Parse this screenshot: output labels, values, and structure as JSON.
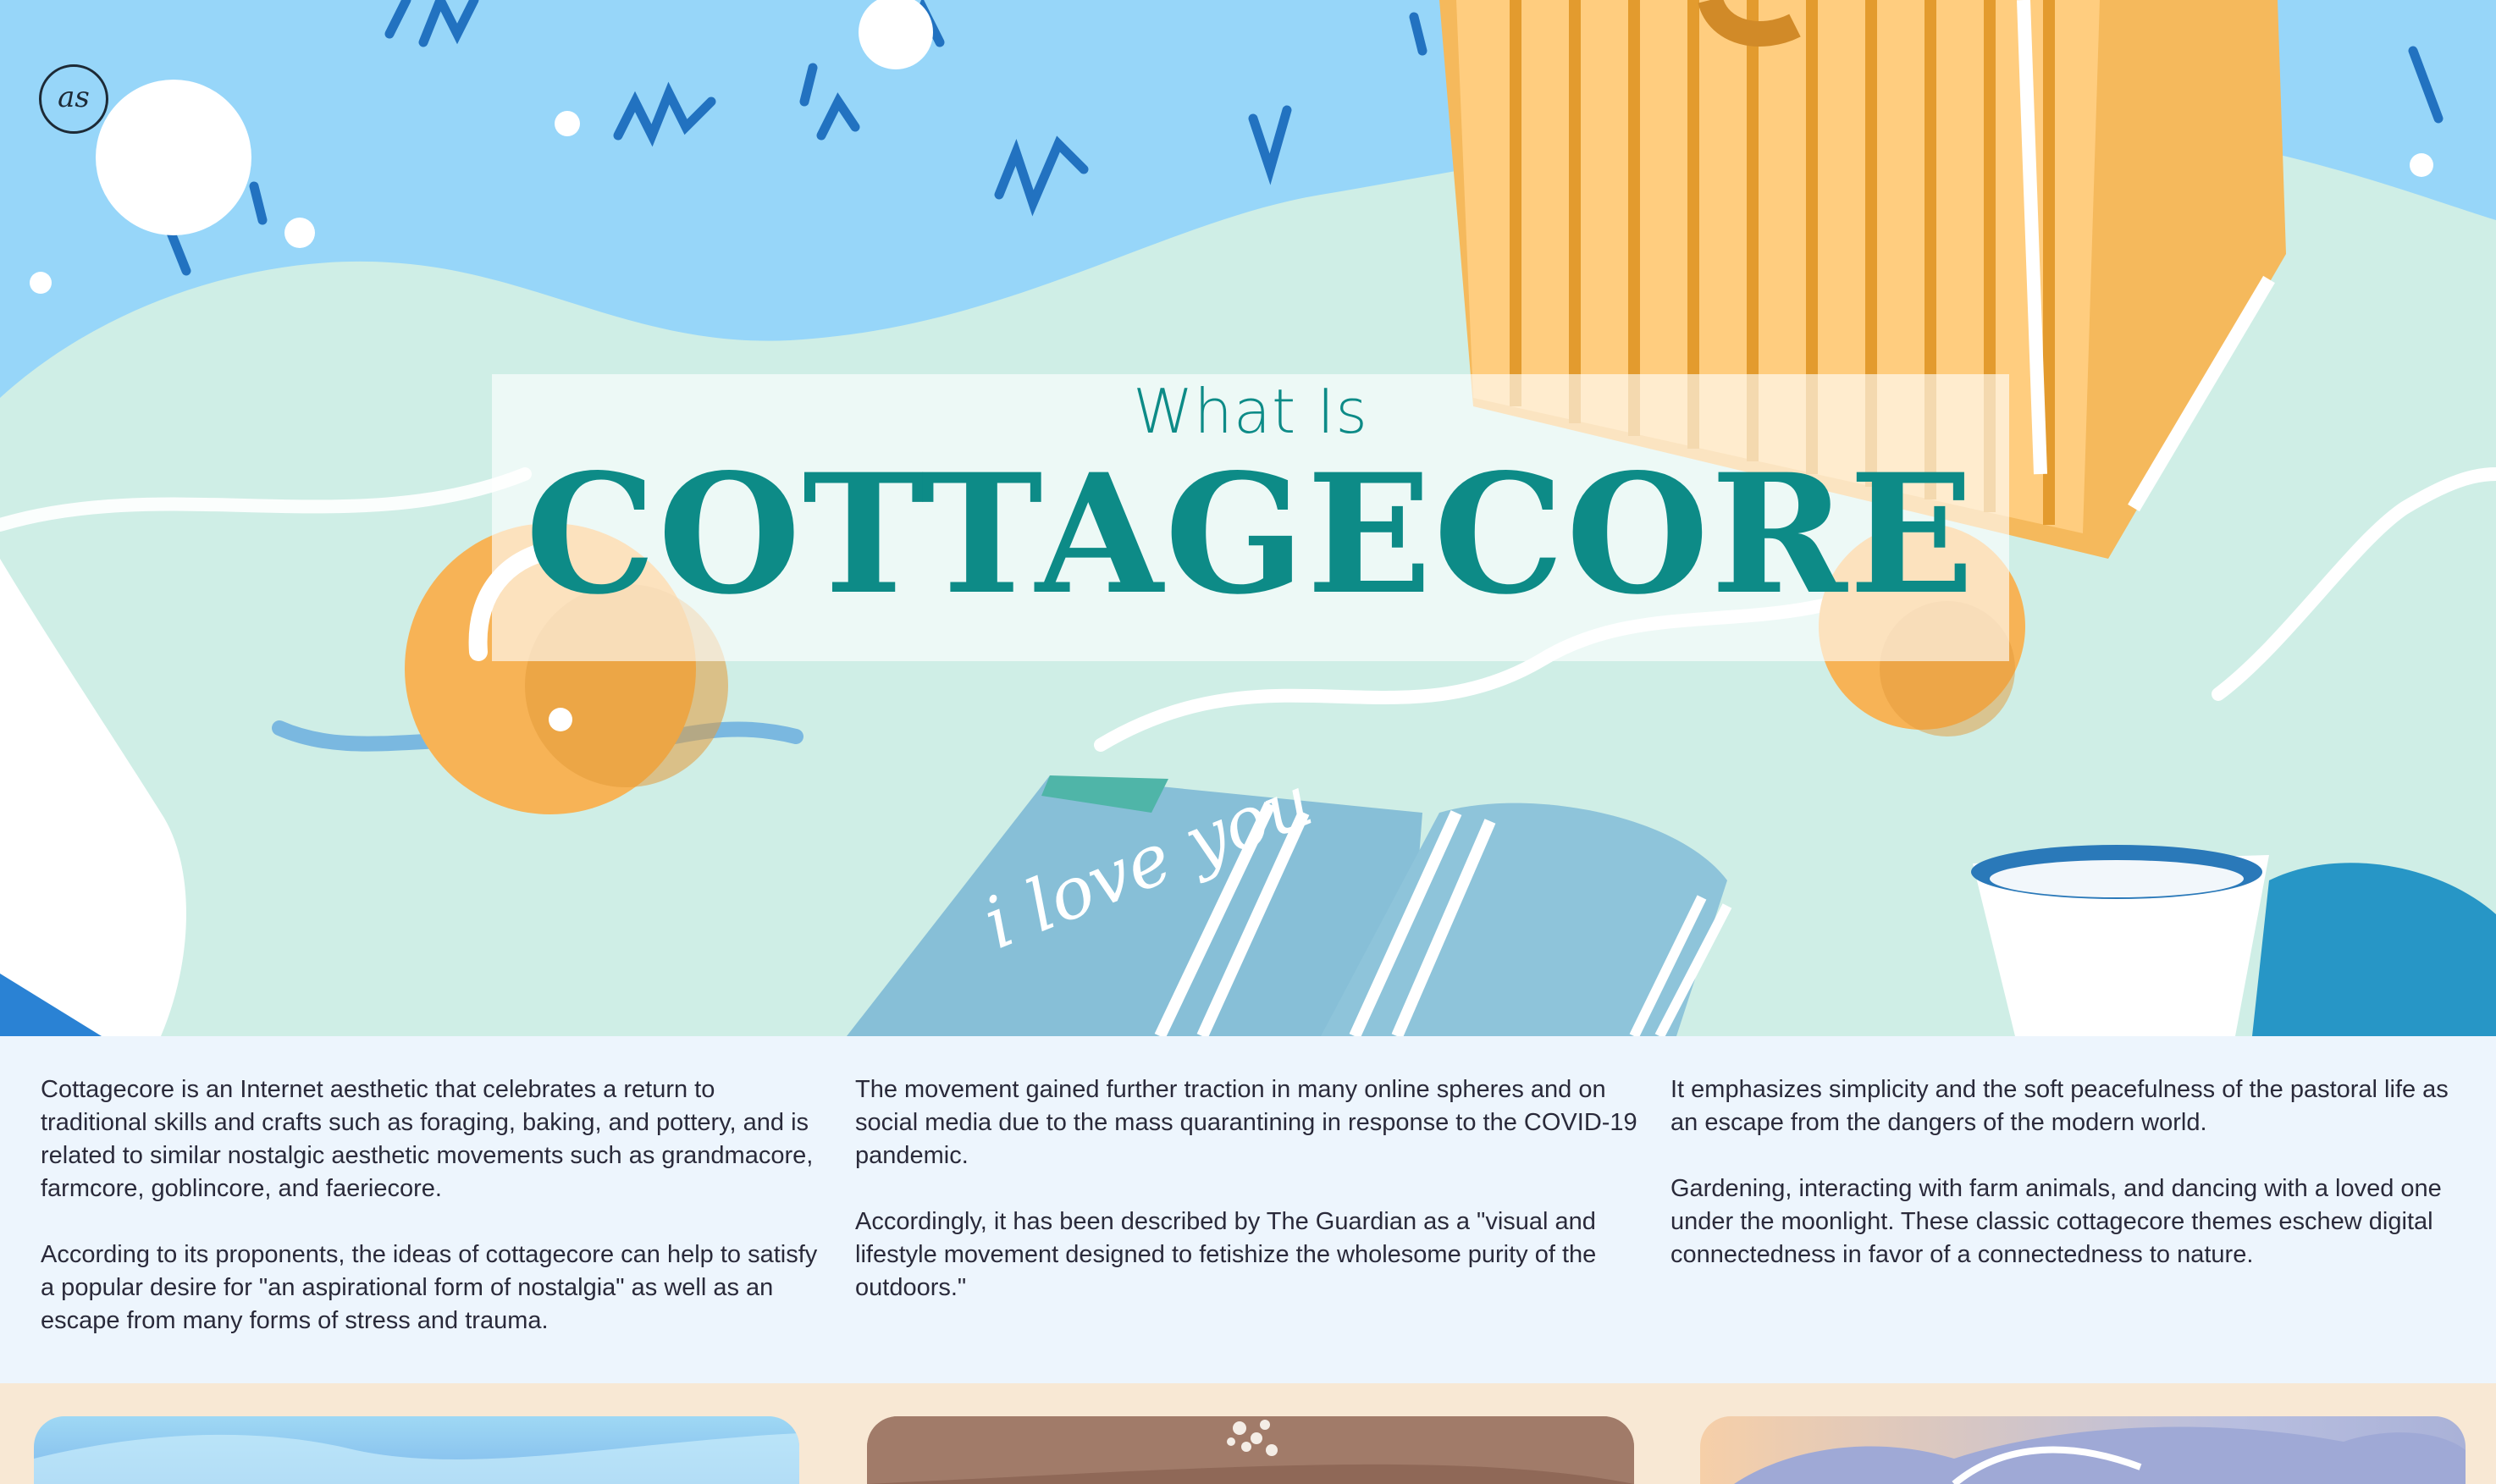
{
  "logo": {
    "text": "as"
  },
  "hero": {
    "title_small": "What Is",
    "title_big": "COTTAGECORE",
    "book_text": "i love you"
  },
  "intro": {
    "columns": [
      {
        "paragraphs": [
          "Cottagecore is an Internet aesthetic that celebrates a return to traditional skills and crafts such as foraging, baking, and pottery, and is related to similar nostalgic aesthetic movements such as grandmacore, farmcore, goblincore, and faeriecore.",
          "According to its proponents, the ideas of cottagecore can help to satisfy a popular desire for \"an aspirational form of nostalgia\" as well as an escape from many forms of stress and trauma."
        ]
      },
      {
        "paragraphs": [
          "The movement gained further traction in many online spheres and on social media due to the mass quarantining in response to the COVID-19 pandemic.",
          "Accordingly, it has been described by The Guardian as a \"visual and lifestyle movement designed to fetishize the wholesome purity of the outdoors.\""
        ]
      },
      {
        "paragraphs": [
          "It emphasizes simplicity and the soft peacefulness of the pastoral life as an escape from the dangers of the modern world.",
          "Gardening, interacting with farm animals, and dancing with a loved one under the moonlight. These classic cottagecore themes eschew digital connectedness in favor of a connectedness to nature."
        ]
      }
    ]
  },
  "colors": {
    "title_teal": "#0d8b87",
    "sky_blue": "#97d6f9",
    "mint": "#cfeee6",
    "intro_bg": "#edf5fd",
    "page_bg": "#f8e8d4"
  }
}
